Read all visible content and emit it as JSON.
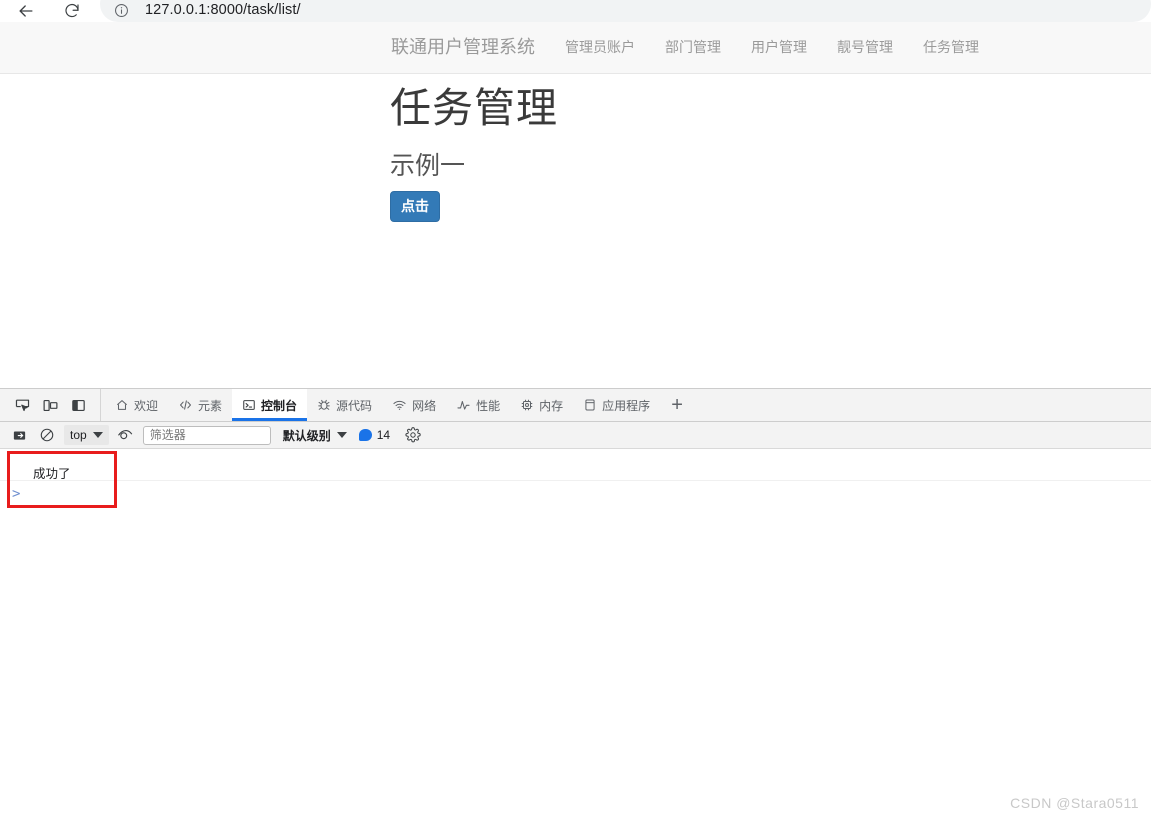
{
  "browser": {
    "back_icon": "back-arrow-icon",
    "reload_icon": "reload-icon",
    "site_info_icon": "info-circle-icon",
    "url": "127.0.0.1:8000/task/list/"
  },
  "page": {
    "navbar": {
      "brand": "联通用户管理系统",
      "links": [
        {
          "label": "管理员账户"
        },
        {
          "label": "部门管理"
        },
        {
          "label": "用户管理"
        },
        {
          "label": "靓号管理"
        },
        {
          "label": "任务管理"
        }
      ]
    },
    "title": "任务管理",
    "subtitle": "示例一",
    "button_label": "点击"
  },
  "devtools": {
    "tool_icons": [
      {
        "name": "inspect-element-icon"
      },
      {
        "name": "device-toolbar-icon"
      },
      {
        "name": "dock-side-icon"
      }
    ],
    "tabs": [
      {
        "label": "欢迎",
        "icon": "home-icon",
        "active": false
      },
      {
        "label": "元素",
        "icon": "code-brackets-icon",
        "active": false
      },
      {
        "label": "控制台",
        "icon": "console-terminal-icon",
        "active": true
      },
      {
        "label": "源代码",
        "icon": "bug-sources-icon",
        "active": false
      },
      {
        "label": "网络",
        "icon": "wifi-network-icon",
        "active": false
      },
      {
        "label": "性能",
        "icon": "performance-pulse-icon",
        "active": false
      },
      {
        "label": "内存",
        "icon": "memory-chip-icon",
        "active": false
      },
      {
        "label": "应用程序",
        "icon": "application-panel-icon",
        "active": false
      }
    ],
    "add_tab_label": "+",
    "console_toolbar": {
      "sidebar_icon": "console-sidebar-icon",
      "clear_icon": "clear-console-icon",
      "context": "top",
      "eye_icon": "live-expression-eye-icon",
      "filter_placeholder": "筛选器",
      "filter_value": "",
      "levels_label": "默认级别",
      "message_count": "14",
      "settings_icon": "settings-gear-icon"
    },
    "console_output": {
      "message": "成功了",
      "prompt": ">"
    }
  },
  "watermark": "CSDN @Stara0511",
  "colors": {
    "accent_blue": "#1a73e8",
    "button_blue": "#337ab7",
    "annotation_red": "#e81c1c",
    "navbar_bg": "#f8f8f8"
  }
}
